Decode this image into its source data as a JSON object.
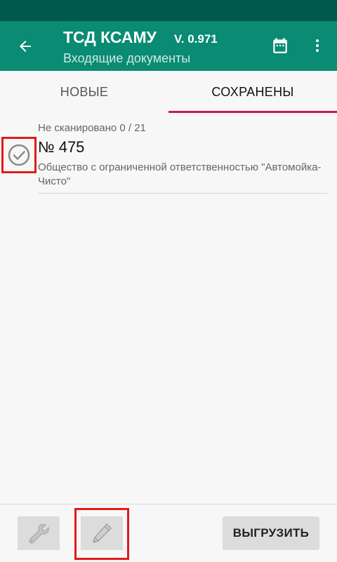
{
  "app_bar": {
    "title": "ТСД КСАМУ",
    "version": "V. 0.971",
    "subtitle": "Входящие документы",
    "color": "#0a8b74",
    "status_bar_color": "#00594a",
    "icons": [
      "arrow-left-icon",
      "calendar-icon",
      "more-vert-icon"
    ]
  },
  "tabs": [
    {
      "label": "НОВЫЕ",
      "active": false
    },
    {
      "label": "СОХРАНЕНЫ",
      "active": true
    }
  ],
  "tab_indicator_color": "#c4195a",
  "documents": [
    {
      "scan_status": "Не сканировано 0 / 21",
      "number": "№ 475",
      "organization": "Общество с ограниченной ответственностью \"Автомойка-Чисто\"",
      "icon": "check-circle-icon"
    }
  ],
  "bottom_bar": {
    "settings_icon": "wrench-icon",
    "edit_icon": "pencil-icon",
    "upload_label": "ВЫГРУЗИТЬ"
  },
  "highlight_color": "#e21b1b"
}
